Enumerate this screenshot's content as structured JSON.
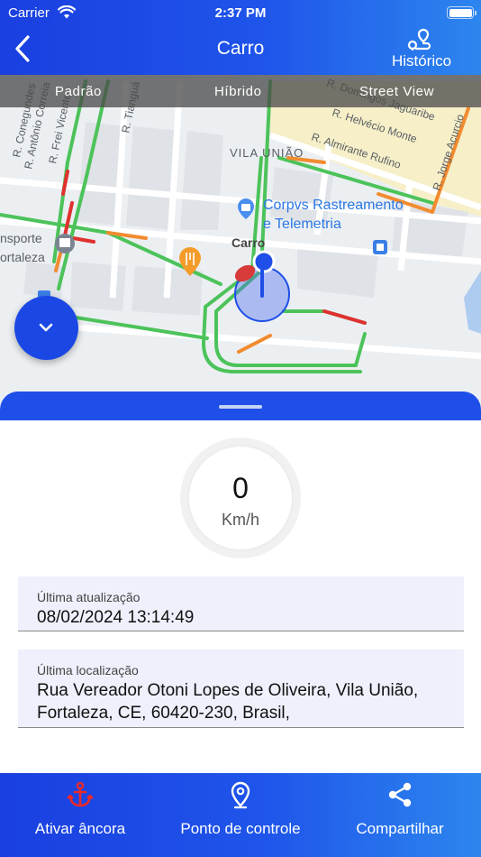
{
  "status_bar": {
    "carrier": "Carrier",
    "time": "2:37 PM"
  },
  "header": {
    "title": "Carro",
    "history_label": "Histórico"
  },
  "map": {
    "tabs": [
      "Padrão",
      "Híbrido",
      "Street View"
    ],
    "streets": [
      "R. Conegundes",
      "R. Antônio Correia",
      "R. Frei Vicente",
      "R. Tianguá",
      "R. Domingos Jaguaribe",
      "R. Helvécio Monte",
      "R. Almirante Rufino",
      "R. Jorge Acurcio"
    ],
    "neighborhood": "VILA UNIÃO",
    "poi_name": "Corpvs Rastreamento e Telemetria",
    "poi_left": "nsporte ortaleza",
    "vehicle_label": "Carro"
  },
  "speed": {
    "value": "0",
    "unit": "Km/h"
  },
  "last_update": {
    "label": "Última atualização",
    "value": "08/02/2024 13:14:49"
  },
  "last_location": {
    "label": "Última localização",
    "value": "Rua Vereador Otoni Lopes de Oliveira, Vila União, Fortaleza, CE, 60420-230, Brasil,"
  },
  "bottom_bar": {
    "anchor_label": "Ativar âncora",
    "checkpoint_label": "Ponto de controle",
    "share_label": "Compartilhar"
  },
  "colors": {
    "primary": "#1f4fe8",
    "anchor_icon": "#e82a2a",
    "route_green": "#4cc35a",
    "route_red": "#e0312f",
    "route_orange": "#f28b2f"
  },
  "icons": [
    "wifi-icon",
    "battery-icon",
    "back-chevron-icon",
    "route-history-icon",
    "chevron-down-icon",
    "anchor-icon",
    "location-pin-icon",
    "share-icon"
  ]
}
